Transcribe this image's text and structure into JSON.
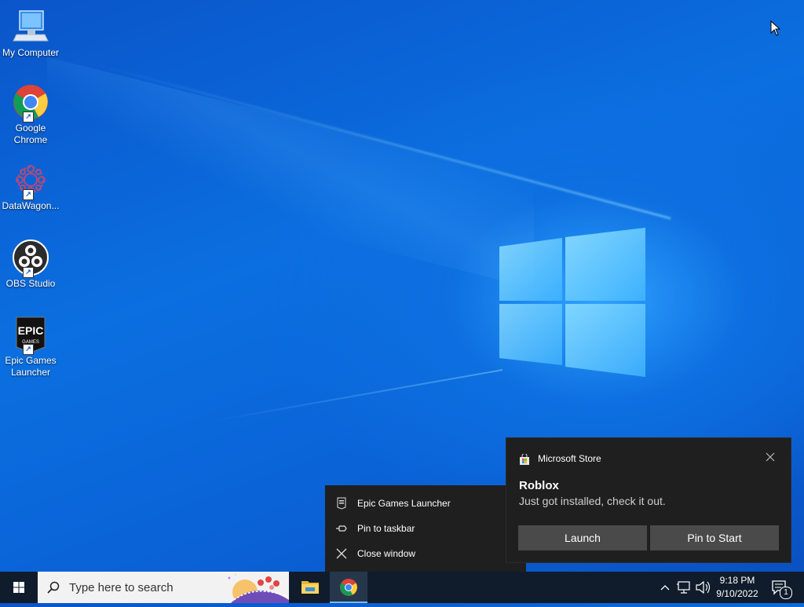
{
  "desktop": {
    "icons": [
      {
        "label": "My Computer",
        "icon": "computer-icon"
      },
      {
        "label": "Google Chrome",
        "icon": "chrome-icon"
      },
      {
        "label": "DataWagon...",
        "icon": "datawagon-icon"
      },
      {
        "label": "OBS Studio",
        "icon": "obs-icon"
      },
      {
        "label": "Epic Games Launcher",
        "icon": "epic-games-icon"
      }
    ],
    "epic_logo_text": [
      "EPIC",
      "GAMES"
    ]
  },
  "context_menu": {
    "items": [
      {
        "label": "Epic Games Launcher",
        "icon": "epic-games-small-icon"
      },
      {
        "label": "Pin to taskbar",
        "icon": "pin-icon"
      },
      {
        "label": "Close window",
        "icon": "close-icon"
      }
    ]
  },
  "toast": {
    "app_name": "Microsoft Store",
    "title": "Roblox",
    "body": "Just got installed, check it out.",
    "buttons": {
      "launch": "Launch",
      "pin": "Pin to Start"
    }
  },
  "taskbar": {
    "search_placeholder": "Type here to search",
    "time": "9:18 PM",
    "date": "9/10/2022",
    "notification_count": "1",
    "apps": [
      "file-explorer-icon",
      "chrome-icon"
    ]
  },
  "colors": {
    "taskbar_bg": "#101c2c",
    "flyout_bg": "#1f1f1f",
    "toast_button": "#4a4a4a",
    "active_indicator": "#76b9ed"
  }
}
